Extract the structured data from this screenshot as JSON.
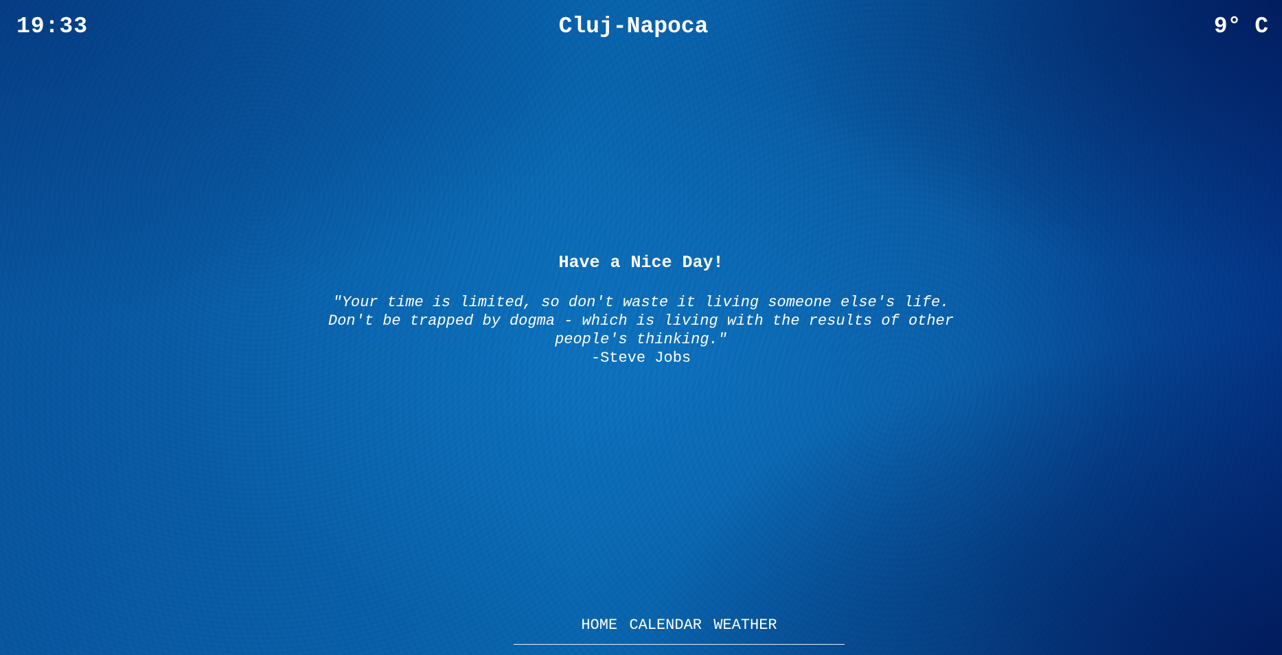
{
  "header": {
    "time": "19:33",
    "city": "Cluj-Napoca",
    "temperature": "9° C"
  },
  "main": {
    "greeting": "Have a Nice Day!",
    "quote": "\"Your time is limited, so don't waste it living someone else's life. Don't be trapped by dogma - which is living with the results of other people's thinking.\"",
    "author": "-Steve Jobs"
  },
  "nav": {
    "items": [
      "HOME",
      "CALENDAR",
      "WEATHER"
    ]
  },
  "colors": {
    "background": "#0a62a8",
    "text": "#ffffff"
  }
}
